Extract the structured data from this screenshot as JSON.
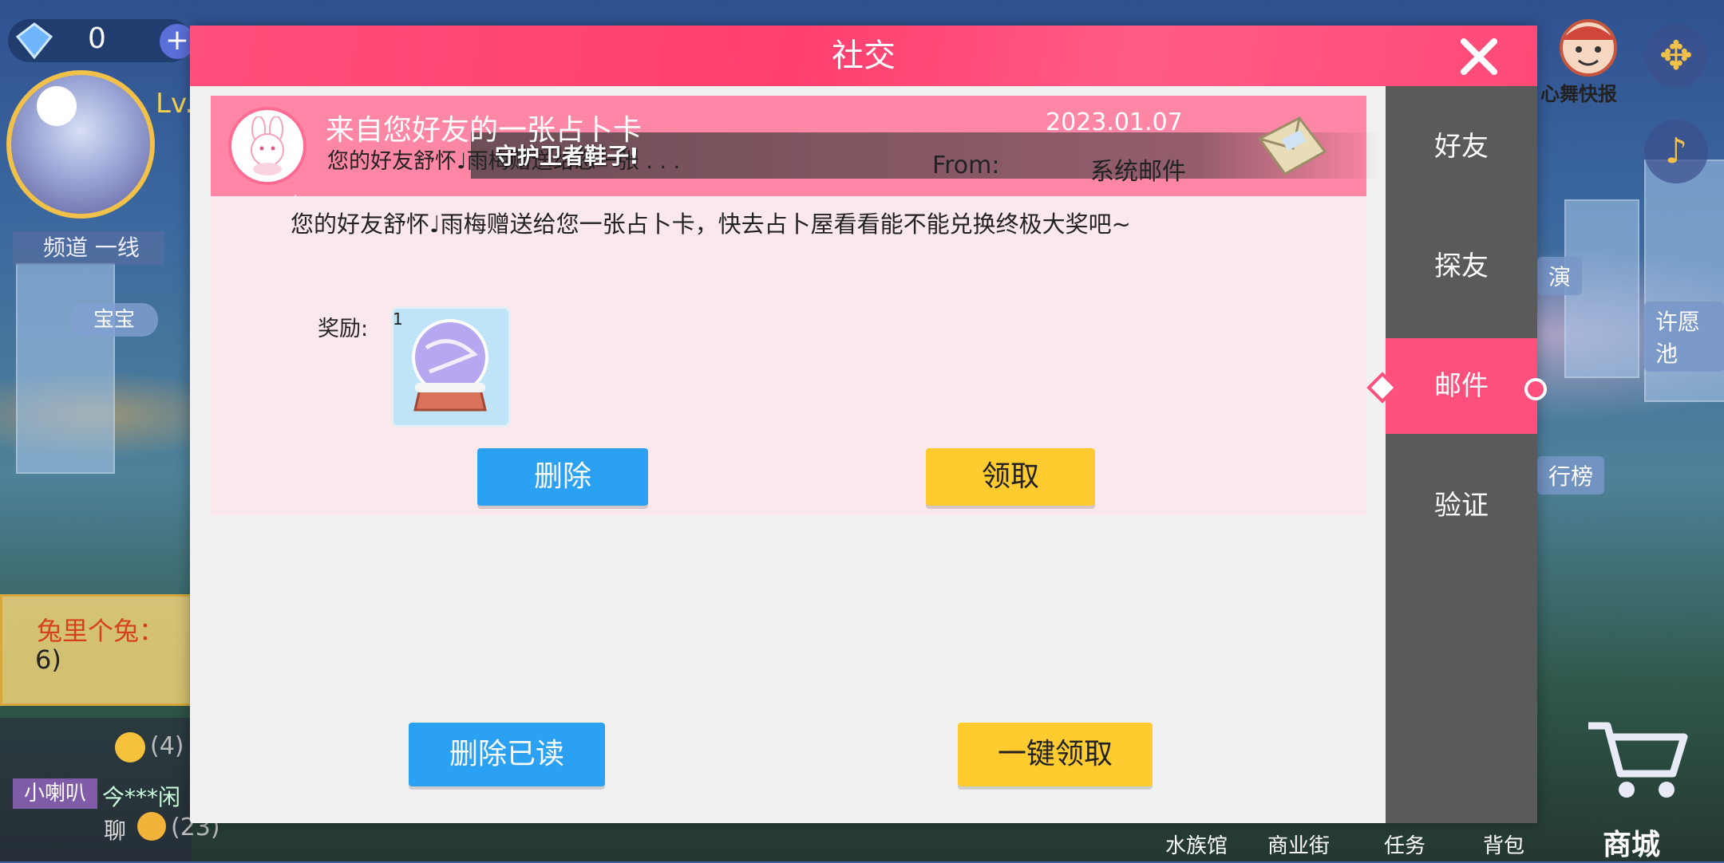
{
  "colors": {
    "accent_pink": "#ff4f7c",
    "side_panel": "#5a5a5a",
    "button_blue": "#2aa1f3",
    "button_yellow": "#ffcb2e"
  },
  "hud": {
    "gem_count": "0",
    "level_prefix": "Lv.",
    "channel": "频道  一线",
    "baby_label": "宝宝",
    "news_label": "心舞快报",
    "signs": [
      "演",
      "许愿池",
      "行榜"
    ],
    "shop_label": "商城",
    "bottom_nav": [
      "水族馆",
      "商业街",
      "任务",
      "背包"
    ],
    "chat": {
      "name": "兔里个兔：",
      "line": "6)",
      "emoji_count_a": "(4)",
      "speaker_label": "小喇叭",
      "speaker_msg": "今***闲",
      "liao": "聊",
      "emoji_count_b": "(23)"
    }
  },
  "dialog": {
    "title": "社交",
    "close_icon": "close-icon",
    "tabs": [
      {
        "label": "好友",
        "active": false
      },
      {
        "label": "探友",
        "active": false
      },
      {
        "label": "邮件",
        "active": true
      },
      {
        "label": "验证",
        "active": false
      }
    ],
    "mail": {
      "subject": "来自您好友的一张占卜卡",
      "preview": "您的好友舒怀♩雨梅赠送给您一张 . . .",
      "banner": "守护卫者鞋子!",
      "date": "2023.01.07",
      "from_label": "From:",
      "from": "系统邮件",
      "body": "您的好友舒怀♩雨梅赠送给您一张占卜卡，快去占卜屋看看能不能兑换终极大奖吧~",
      "reward_label": "奖励:",
      "reward_count": "1",
      "reward_icon": "crystal-ball-icon",
      "delete_label": "删除",
      "claim_label": "领取"
    },
    "footer": {
      "delete_read_label": "删除已读",
      "claim_all_label": "一键领取"
    }
  }
}
